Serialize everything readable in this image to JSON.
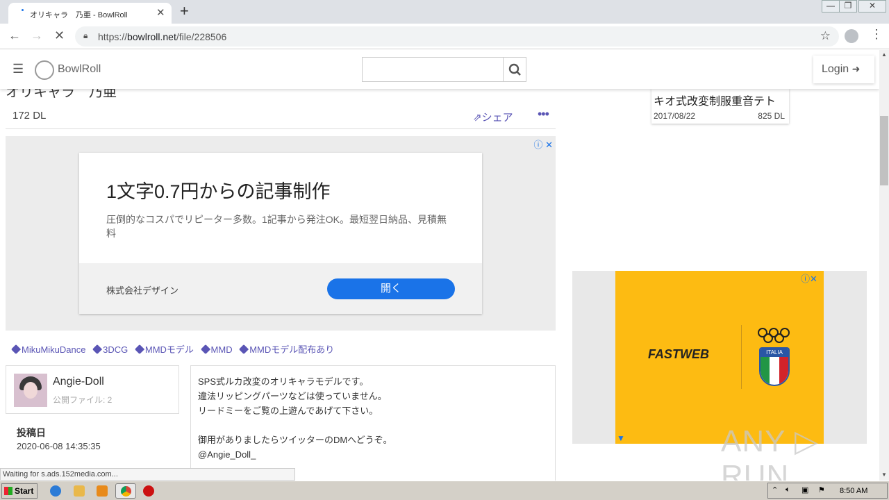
{
  "browser": {
    "tab_title": "オリキャラ　乃亜 - BowlRoll",
    "tab_close": "✕",
    "new_tab": "+",
    "url_prefix": "https://",
    "url_domain": "bowlroll.net",
    "url_path": "/file/228506",
    "window_controls": [
      "—",
      "❐",
      "✕"
    ]
  },
  "site": {
    "logo_text": "BowlRoll",
    "search_value": "",
    "login_label": "Login"
  },
  "file": {
    "cut_title": "オリキャラ　乃亜",
    "download_count": "172 DL",
    "share_label": "シェア",
    "more_label": "•••",
    "tags": [
      "MikuMikuDance",
      "3DCG",
      "MMDモデル",
      "MMD",
      "MMDモデル配布あり"
    ],
    "author": {
      "name": "Angie-Doll",
      "files_label": "公開ファイル: 2"
    },
    "posted_label": "投稿日",
    "posted_date": "2020-06-08 14:35:35",
    "description": [
      "SPS式ルカ改変のオリキャラモデルです。",
      "違法リッピングパーツなどは使っていません。",
      "リードミーをご覧の上遊んであげて下さい。",
      "",
      "御用がありましたらツイッターのDMへどうぞ。",
      "@Angie_Doll_"
    ]
  },
  "ad_main": {
    "headline": "1文字0.7円からの記事制作",
    "body": "圧倒的なコスパでリピーター多数。1記事から発注OK。最短翌日納品、見積無料",
    "company": "株式会社デザイン",
    "button": "開く",
    "icons": "ⓘ ✕"
  },
  "sidebar": {
    "related": {
      "title": "キオ式改変制服重音テト",
      "date": "2017/08/22",
      "downloads": "825 DL"
    },
    "ad": {
      "brand": "FASTWEB",
      "shield_text": "ITALIA",
      "icons": "ⓘ✕"
    }
  },
  "status_text": "Waiting for s.ads.152media.com...",
  "watermark": "ANY ▷ RUN",
  "taskbar": {
    "start_label": "Start",
    "clock": "8:50 AM"
  },
  "colors": {
    "accent": "#5a55b5",
    "ad_button": "#1a73e8",
    "ad2_background": "#fdbb12"
  }
}
